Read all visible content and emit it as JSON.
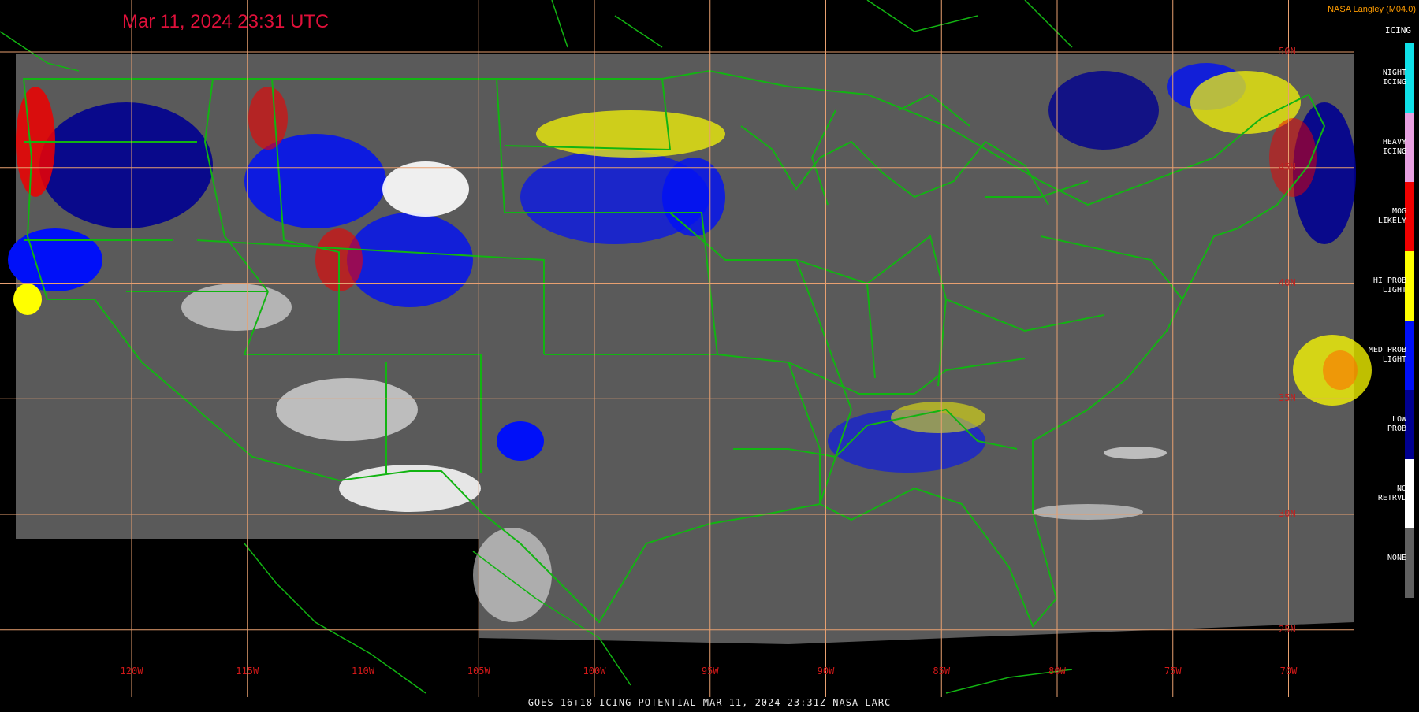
{
  "title": "Mar 11, 2024 23:31 UTC",
  "credit": "NASA Langley (M04.0)",
  "footer": "GOES-16+18  ICING POTENTIAL   MAR 11, 2024 23:31Z   NASA LARC",
  "colors": {
    "background": "#000000",
    "map_fill": "#5a5a5a",
    "borders": "#12b412",
    "grid": "#e8a070",
    "title": "#e0103a"
  },
  "longitudes": [
    {
      "label": "120W",
      "value": -120
    },
    {
      "label": "115W",
      "value": -115
    },
    {
      "label": "110W",
      "value": -110
    },
    {
      "label": "105W",
      "value": -105
    },
    {
      "label": "100W",
      "value": -100
    },
    {
      "label": "95W",
      "value": -95
    },
    {
      "label": "90W",
      "value": -90
    },
    {
      "label": "85W",
      "value": -85
    },
    {
      "label": "80W",
      "value": -80
    },
    {
      "label": "75W",
      "value": -75
    },
    {
      "label": "70W",
      "value": -70
    }
  ],
  "latitudes": [
    {
      "label": "50N",
      "value": 50
    },
    {
      "label": "45N",
      "value": 45
    },
    {
      "label": "40N",
      "value": 40
    },
    {
      "label": "35N",
      "value": 35
    },
    {
      "label": "30N",
      "value": 30
    },
    {
      "label": "25N",
      "value": 25
    }
  ],
  "legend": {
    "title": "ICING",
    "items": [
      {
        "label": "NIGHT\nICING",
        "color": "#10e0e8"
      },
      {
        "label": "HEAVY\nICING",
        "color": "#e8a0e0"
      },
      {
        "label": "MOG\nLIKELY",
        "color": "#f00000"
      },
      {
        "label": "HI PROB\nLIGHT",
        "color": "#ffff00"
      },
      {
        "label": "MED PROB\nLIGHT",
        "color": "#0010f8"
      },
      {
        "label": "LOW\nPROB",
        "color": "#000090"
      },
      {
        "label": "NO\nRETRVL",
        "color": "#ffffff"
      },
      {
        "label": "NONE",
        "color": "#606060"
      }
    ]
  }
}
